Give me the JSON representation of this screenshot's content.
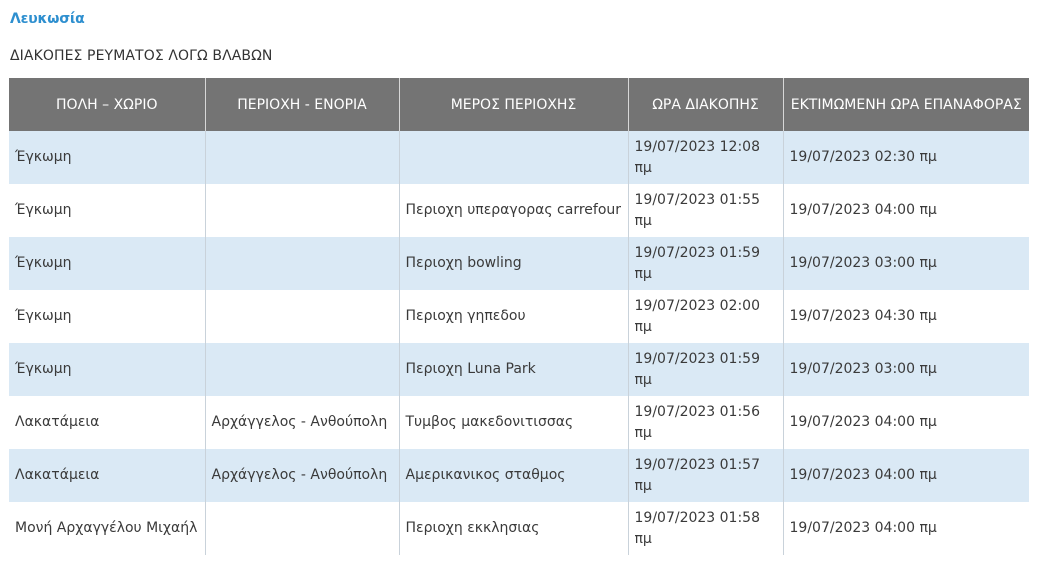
{
  "city": "Λευκωσία",
  "title": "ΔΙΑΚΟΠΕΣ ΡΕΥΜΑΤΟΣ ΛΟΓΩ ΒΛΑΒΩΝ",
  "table": {
    "headers": [
      "ΠΟΛΗ – ΧΩΡΙΟ",
      "ΠΕΡΙΟΧΗ - ΕΝΟΡΙΑ",
      "ΜΕΡΟΣ ΠΕΡΙΟΧΗΣ",
      "ΩΡΑ ΔΙΑΚΟΠΗΣ",
      "ΕΚΤΙΜΩΜΕΝΗ ΩΡΑ ΕΠΑΝΑΦΟΡΑΣ"
    ],
    "rows": [
      [
        "Έγκωμη",
        "",
        "",
        "19/07/2023 12:08 πμ",
        "19/07/2023 02:30 πμ"
      ],
      [
        "Έγκωμη",
        "",
        "Περιοχη υπεραγορας carrefour",
        "19/07/2023 01:55 πμ",
        "19/07/2023 04:00 πμ"
      ],
      [
        "Έγκωμη",
        "",
        "Περιοχη bowling",
        "19/07/2023 01:59 πμ",
        "19/07/2023 03:00 πμ"
      ],
      [
        "Έγκωμη",
        "",
        "Περιοχη γηπεδου",
        "19/07/2023 02:00 πμ",
        "19/07/2023 04:30 πμ"
      ],
      [
        "Έγκωμη",
        "",
        "Περιοχη Luna Park",
        "19/07/2023 01:59 πμ",
        "19/07/2023 03:00 πμ"
      ],
      [
        "Λακατάμεια",
        "Αρχάγγελος - Ανθούπολη",
        "Τυμβος μακεδονιτισσας",
        "19/07/2023 01:56 πμ",
        "19/07/2023 04:00 πμ"
      ],
      [
        "Λακατάμεια",
        "Αρχάγγελος - Ανθούπολη",
        "Αμερικανικος σταθμος",
        "19/07/2023 01:57 πμ",
        "19/07/2023 04:00 πμ"
      ],
      [
        "Μονή Αρχαγγέλου Μιχαήλ",
        "",
        "Περιοχη εκκλησιας",
        "19/07/2023 01:58 πμ",
        "19/07/2023 04:00 πμ"
      ]
    ]
  }
}
